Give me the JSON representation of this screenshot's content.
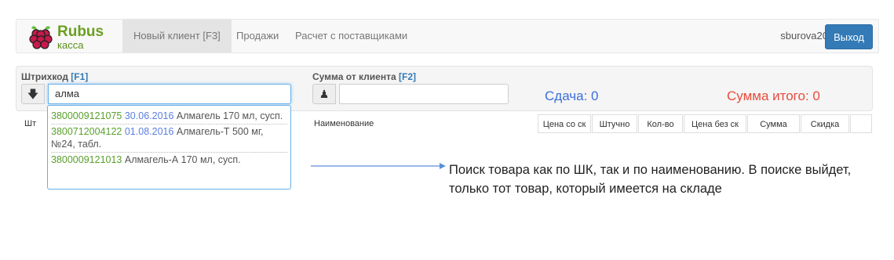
{
  "brand": {
    "title": "Rubus",
    "subtitle": "касса"
  },
  "nav": {
    "items": [
      {
        "label": "Новый клиент [F3]"
      },
      {
        "label": "Продажи"
      },
      {
        "label": "Расчет с поставщиками"
      }
    ],
    "user": "sburova20",
    "logout": "Выход"
  },
  "barcode": {
    "label": "Штрихкод",
    "key": "[F1]",
    "value": "алма"
  },
  "client_sum": {
    "label": "Сумма от клиента",
    "key": "[F2]",
    "value": ""
  },
  "change": "Сдача: 0",
  "total": "Сумма итого: 0",
  "table": {
    "headers": [
      "Шт",
      "Наименование",
      "Цена со ск",
      "Штучно",
      "Кол-во",
      "Цена без ск",
      "Сумма",
      "Скидка"
    ]
  },
  "suggestions": [
    {
      "code": "3800009121075",
      "date": "30.06.2016",
      "name": "Алмагель 170 мл, сусп."
    },
    {
      "code": "3800712004122",
      "date": "01.08.2016",
      "name": "Алмагель-Т 500 мг, №24, табл."
    },
    {
      "code": "3800009121013",
      "date": "",
      "name": "Алмагель-А 170 мл, сусп."
    }
  ],
  "annotation": "Поиск товара как по ШК, так и по наименованию. В поиске выйдет, только тот товар, который имеется на складе",
  "colors": {
    "accent": "#337ab7",
    "brand": "#6a9f1f",
    "change": "#3a6fdb",
    "total": "#e74c3c"
  }
}
